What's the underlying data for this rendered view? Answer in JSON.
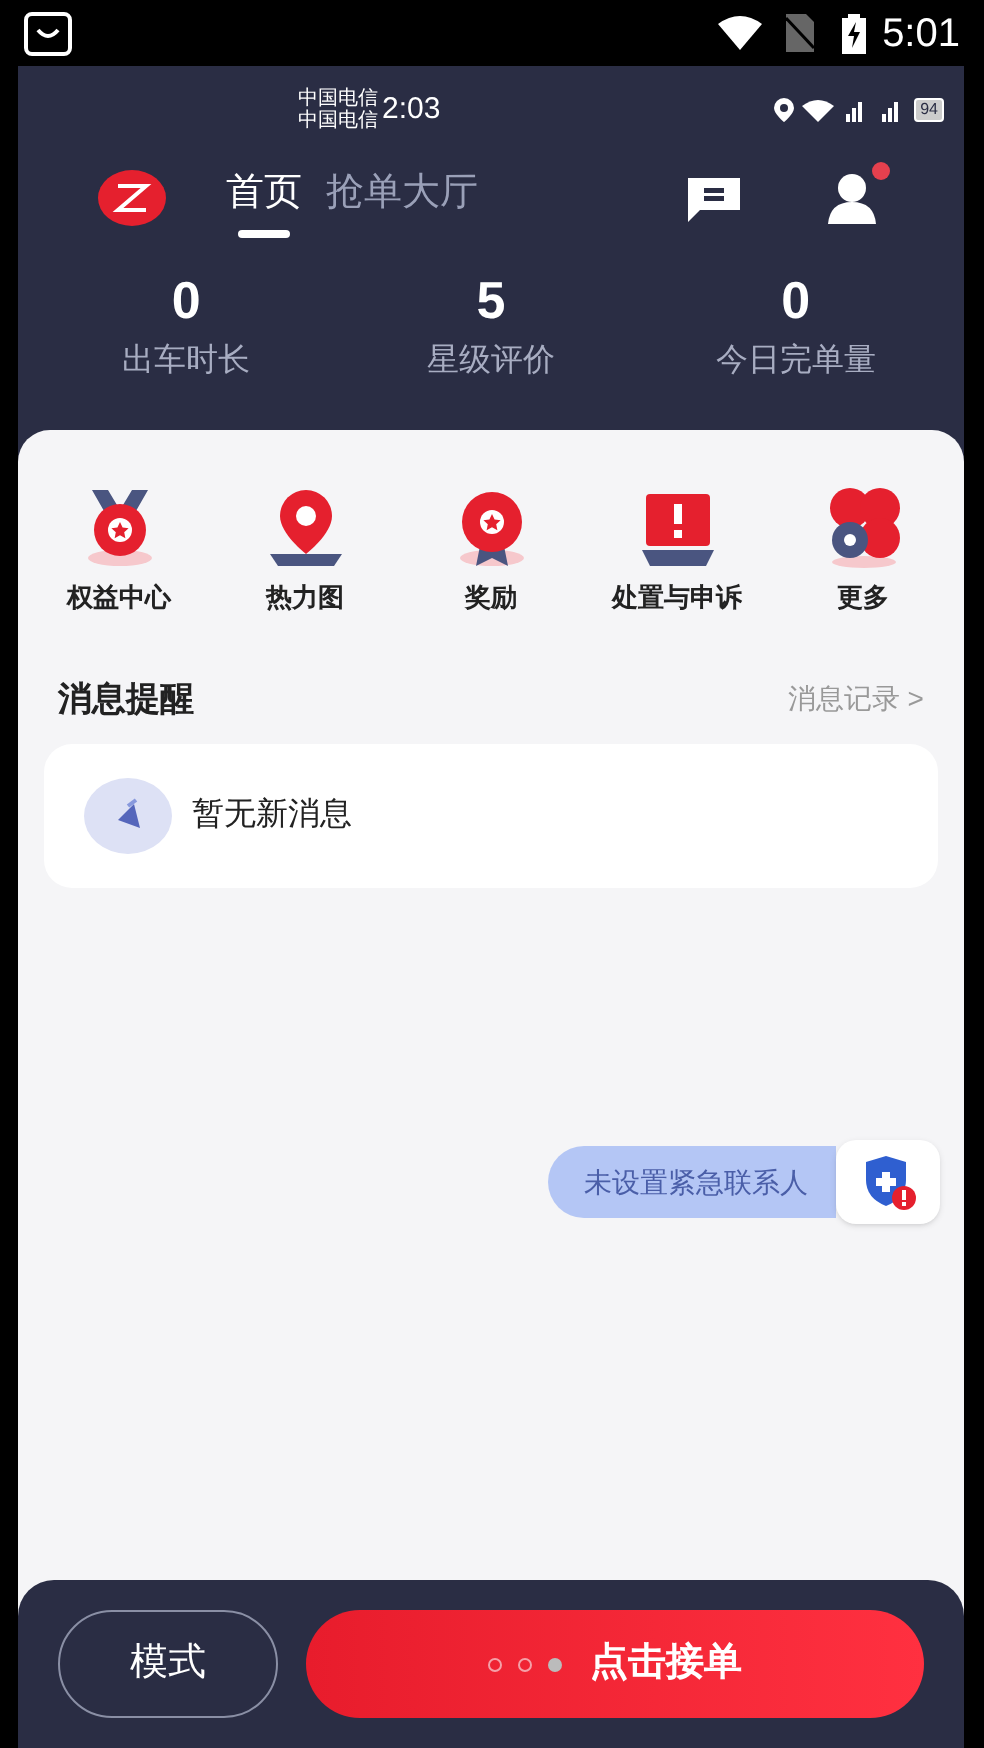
{
  "system_status_bar": {
    "time": "5:01"
  },
  "app_status_bar": {
    "carrier_lines": [
      "中国电信",
      "中国电信"
    ],
    "time": "2:03",
    "battery": "94"
  },
  "header": {
    "tabs": [
      {
        "label": "首页",
        "selected": true
      },
      {
        "label": "抢单大厅",
        "selected": false
      }
    ],
    "profile_badge": true
  },
  "stats": [
    {
      "value": "0",
      "label": "出车时长"
    },
    {
      "value": "5",
      "label": "星级评价"
    },
    {
      "value": "0",
      "label": "今日完单量"
    }
  ],
  "shortcuts": [
    {
      "label": "权益中心",
      "kind": "medal"
    },
    {
      "label": "热力图",
      "kind": "pin"
    },
    {
      "label": "奖励",
      "kind": "award"
    },
    {
      "label": "处置与申诉",
      "kind": "alert"
    },
    {
      "label": "更多",
      "kind": "more"
    }
  ],
  "messages": {
    "title": "消息提醒",
    "link": "消息记录 >",
    "empty_text": "暂无新消息"
  },
  "emergency": {
    "text": "未设置紧急联系人"
  },
  "bottom_bar": {
    "mode_button": "模式",
    "main_button": "点击接单",
    "dots": [
      {
        "selected": false
      },
      {
        "selected": false
      },
      {
        "selected": true
      }
    ]
  }
}
